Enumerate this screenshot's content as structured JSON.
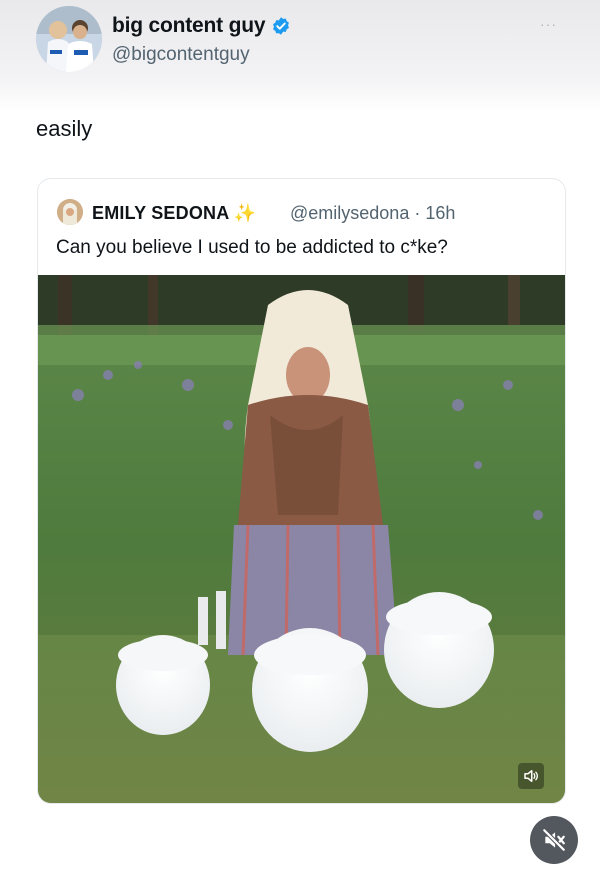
{
  "author": {
    "display_name": "big content guy",
    "handle": "@bigcontentguy",
    "verified_icon": "verified-badge-icon",
    "verified_color": "#1d9bf0"
  },
  "more_label": "···",
  "tweet_text": "easily",
  "quoted_tweet": {
    "display_name": "EMILY SEDONA",
    "emoji": "✨",
    "handle": "@emilysedona",
    "separator": "·",
    "time": "16h",
    "text": "Can you believe I used to be addicted to c*ke?"
  },
  "media": {
    "type": "video",
    "volume_icon": "speaker-icon",
    "mute_icon": "muted-speaker-icon"
  }
}
